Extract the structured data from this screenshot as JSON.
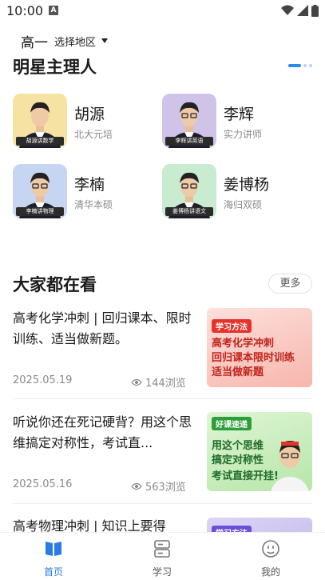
{
  "status_bar": {
    "time": "10:00",
    "notification_letter": "A"
  },
  "header": {
    "grade": "高一",
    "region": "选择地区"
  },
  "teachers_section": {
    "title": "明星主理人",
    "teachers": [
      {
        "name": "胡源",
        "desc": "北大元培",
        "photo_caption": "胡源讲数学",
        "bg": "#f6e3a4"
      },
      {
        "name": "李辉",
        "desc": "实力讲师",
        "photo_caption": "李辉讲英语",
        "bg": "#cfc4e8"
      },
      {
        "name": "李楠",
        "desc": "清华本硕",
        "photo_caption": "李楠讲物理",
        "bg": "#c6d6f2"
      },
      {
        "name": "姜博杨",
        "desc": "海归双硕",
        "photo_caption": "姜博杨讲语文",
        "bg": "#c9ebcf"
      }
    ]
  },
  "popular_section": {
    "title": "大家都在看",
    "more_label": "更多",
    "articles": [
      {
        "title": "高考化学冲刺 | 回归课本、限时训练、适当做新题。",
        "date": "2025.05.19",
        "views": "144浏览",
        "thumb_tag": "学习方法",
        "thumb_text": [
          "高考化学冲刺",
          "回归课本限时训练",
          "适当做新题"
        ]
      },
      {
        "title": "听说你还在死记硬背？用这个思维搞定对称性，考试直...",
        "date": "2025.05.16",
        "views": "563浏览",
        "thumb_tag": "好课速递",
        "thumb_text": [
          "用这个思维",
          "搞定对称性",
          "考试直接开挂!"
        ]
      },
      {
        "title": "高考物理冲刺 | 知识上要得",
        "thumb_tag": "学习方法"
      }
    ]
  },
  "bottom_nav": {
    "items": [
      {
        "label": "首页",
        "active": true
      },
      {
        "label": "学习",
        "active": false
      },
      {
        "label": "我的",
        "active": false
      }
    ]
  },
  "colors": {
    "accent": "#2a7be4",
    "dot_active": "#2a8cf0"
  }
}
